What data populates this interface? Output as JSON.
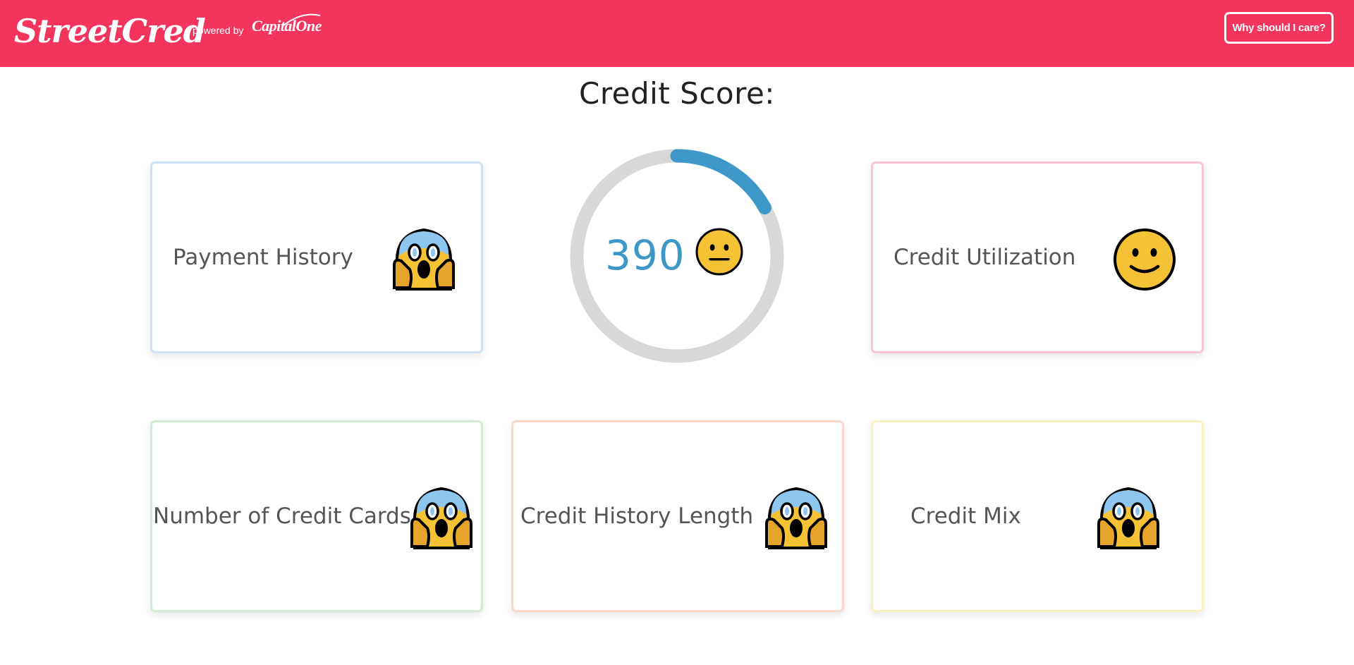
{
  "navbar": {
    "brand": "StreetCred",
    "powered_by": "powered by",
    "partner": "CapitalOne",
    "care_button": "Why should I care?",
    "bg_color": "#f3345d"
  },
  "title": "Credit Score:",
  "score": {
    "value": "390",
    "progress_fraction": 0.17,
    "mood": "neutral-face",
    "accent_color": "#3e97c9"
  },
  "factors": [
    {
      "label": "Payment History",
      "mood": "screaming-face",
      "border_color": "#cfe0f3"
    },
    {
      "label": "Credit Utilization",
      "mood": "slight-smile-face",
      "border_color": "#f8c6d1"
    },
    {
      "label": "Number of Credit Cards",
      "mood": "screaming-face",
      "border_color": "#d3ebd3"
    },
    {
      "label": "Credit History Length",
      "mood": "screaming-face",
      "border_color": "#fbd6cb"
    },
    {
      "label": "Credit Mix",
      "mood": "screaming-face",
      "border_color": "#fbf1c3"
    }
  ]
}
